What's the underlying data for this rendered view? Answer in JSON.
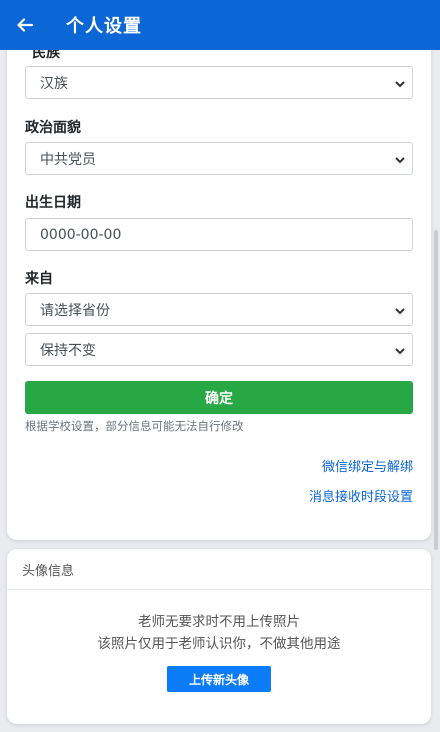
{
  "header": {
    "title": "个人设置"
  },
  "form": {
    "ethnicity": {
      "label": "民族",
      "value": "汉族"
    },
    "political": {
      "label": "政治面貌",
      "value": "中共党员"
    },
    "birthdate": {
      "label": "出生日期",
      "placeholder": "0000-00-00"
    },
    "origin": {
      "label": "来自",
      "province": "请选择省份",
      "keep": "保持不变"
    },
    "confirm_label": "确定",
    "hint": "根据学校设置，部分信息可能无法自行修改",
    "links": {
      "wechat": "微信绑定与解绑",
      "notify": "消息接收时段设置"
    }
  },
  "avatar": {
    "section_title": "头像信息",
    "line1": "老师无要求时不用上传照片",
    "line2": "该照片仅用于老师认识你，不做其他用途",
    "upload_label": "上传新头像"
  }
}
